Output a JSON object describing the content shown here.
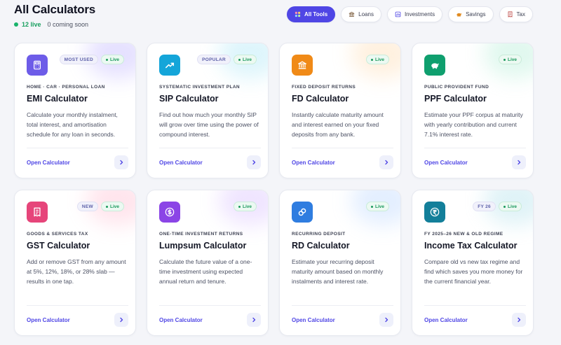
{
  "header": {
    "title": "All Calculators",
    "live_count": "12 live",
    "coming_soon": "0 coming soon"
  },
  "filters": [
    {
      "label": "All Tools",
      "icon": "grid-icon",
      "active": true
    },
    {
      "label": "Loans",
      "icon": "bank-icon",
      "active": false
    },
    {
      "label": "Investments",
      "icon": "chart-icon",
      "active": false
    },
    {
      "label": "Savings",
      "icon": "piggy-bank-icon",
      "active": false
    },
    {
      "label": "Tax",
      "icon": "receipt-icon",
      "active": false
    }
  ],
  "colors": {
    "accent": "#4f46e5",
    "live": "#1a9a5c"
  },
  "live_label": "Live",
  "open_label": "Open Calculator",
  "cards": [
    {
      "category": "HOME · CAR · PERSONAL LOAN",
      "title": "EMI Calculator",
      "desc": "Calculate your monthly instalment, total interest, and amortisation schedule for any loan in seconds.",
      "tag": "MOST USED",
      "icon": "calculator-icon",
      "color": "#6d5ce8",
      "glow": "#b6a9ff"
    },
    {
      "category": "SYSTEMATIC INVESTMENT PLAN",
      "title": "SIP Calculator",
      "desc": "Find out how much your monthly SIP will grow over time using the power of compound interest.",
      "tag": "POPULAR",
      "icon": "trend-up-icon",
      "color": "#14a5d9",
      "glow": "#9fe3f5"
    },
    {
      "category": "FIXED DEPOSIT RETURNS",
      "title": "FD Calculator",
      "desc": "Instantly calculate maturity amount and interest earned on your fixed deposits from any bank.",
      "tag": "",
      "icon": "bank-icon",
      "color": "#f08a17",
      "glow": "#ffd7a6"
    },
    {
      "category": "PUBLIC PROVIDENT FUND",
      "title": "PPF Calculator",
      "desc": "Estimate your PPF corpus at maturity with yearly contribution and current 7.1% interest rate.",
      "tag": "",
      "icon": "piggy-bank-icon",
      "color": "#0f9f6e",
      "glow": "#a8ebd0"
    },
    {
      "category": "GOODS & SERVICES TAX",
      "title": "GST Calculator",
      "desc": "Add or remove GST from any amount at 5%, 12%, 18%, or 28% slab — results in one tap.",
      "tag": "NEW",
      "icon": "receipt-icon",
      "color": "#e6457a",
      "glow": "#ffb4cb"
    },
    {
      "category": "ONE-TIME INVESTMENT RETURNS",
      "title": "Lumpsum Calculator",
      "desc": "Calculate the future value of a one-time investment using expected annual return and tenure.",
      "tag": "",
      "icon": "dollar-coin-icon",
      "color": "#8b45e6",
      "glow": "#d2b4ff"
    },
    {
      "category": "RECURRING DEPOSIT",
      "title": "RD Calculator",
      "desc": "Estimate your recurring deposit maturity amount based on monthly instalments and interest rate.",
      "tag": "",
      "icon": "repeat-icon",
      "color": "#2f7de0",
      "glow": "#b0d0ff"
    },
    {
      "category": "FY 2025–26 NEW & OLD REGIME",
      "title": "Income Tax Calculator",
      "desc": "Compare old vs new tax regime and find which saves you more money for the current financial year.",
      "tag": "FY 26",
      "icon": "rupee-coin-icon",
      "color": "#137f9a",
      "glow": "#a5dce8"
    }
  ]
}
